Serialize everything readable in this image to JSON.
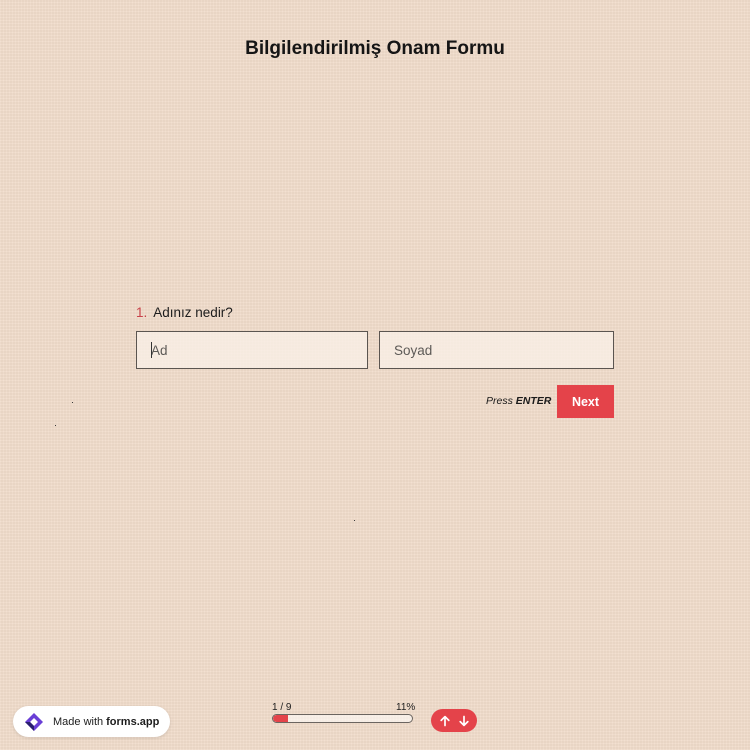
{
  "form": {
    "title": "Bilgilendirilmiş Onam Formu"
  },
  "question": {
    "number": "1.",
    "text": "Adınız nedir?"
  },
  "fields": {
    "first_name": {
      "placeholder": "Ad",
      "value": ""
    },
    "last_name": {
      "placeholder": "Soyad",
      "value": ""
    }
  },
  "actions": {
    "press_label": "Press",
    "enter_label": "ENTER",
    "next_label": "Next"
  },
  "footer": {
    "badge_prefix": "Made with",
    "badge_brand": "forms.app",
    "progress_count": "1 / 9",
    "progress_percent": "11%",
    "progress_fraction": 0.11,
    "nav_up_icon": "arrow-up-icon",
    "nav_down_icon": "arrow-down-icon"
  },
  "colors": {
    "accent": "#e4434a",
    "background": "#f1dccb",
    "question_number": "#c8424a",
    "logo_primary": "#6a3fd6",
    "logo_secondary": "#2a1f6e"
  }
}
